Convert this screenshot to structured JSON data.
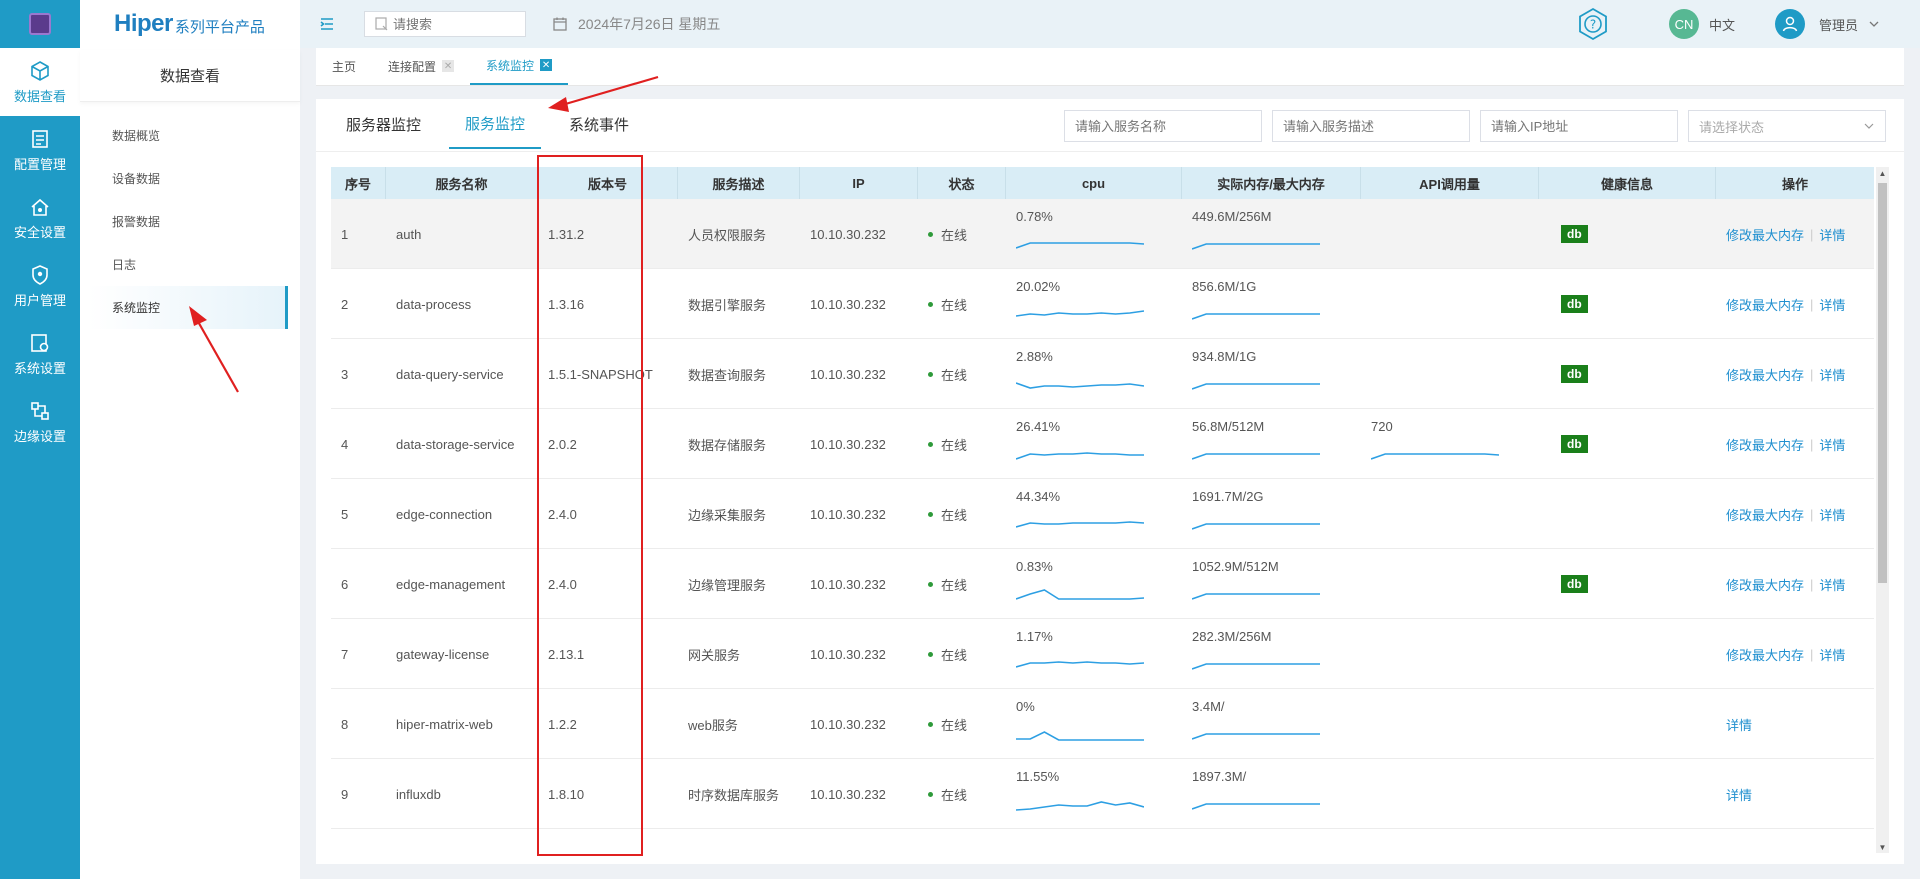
{
  "rail": [
    {
      "label": "数据查看",
      "icon": "cube-icon",
      "active": true
    },
    {
      "label": "配置管理",
      "icon": "config-icon",
      "active": false
    },
    {
      "label": "安全设置",
      "icon": "security-icon",
      "active": false
    },
    {
      "label": "用户管理",
      "icon": "user-shield-icon",
      "active": false
    },
    {
      "label": "系统设置",
      "icon": "system-settings-icon",
      "active": false
    },
    {
      "label": "边缘设置",
      "icon": "edge-icon",
      "active": false
    }
  ],
  "brand": {
    "name": "Hiper",
    "suffix": "系列平台产品"
  },
  "sidebar": {
    "title": "数据查看",
    "items": [
      {
        "label": "数据概览"
      },
      {
        "label": "设备数据"
      },
      {
        "label": "报警数据"
      },
      {
        "label": "日志"
      },
      {
        "label": "系统监控"
      }
    ]
  },
  "header": {
    "search_placeholder": "请搜索",
    "date": "2024年7月26日 星期五",
    "lang_badge": "CN",
    "lang_label": "中文",
    "user": "管理员"
  },
  "page_tabs": [
    {
      "label": "主页"
    },
    {
      "label": "连接配置"
    },
    {
      "label": "系统监控"
    }
  ],
  "sub_tabs": [
    {
      "label": "服务器监控"
    },
    {
      "label": "服务监控"
    },
    {
      "label": "系统事件"
    }
  ],
  "filters": {
    "name_placeholder": "请输入服务名称",
    "desc_placeholder": "请输入服务描述",
    "ip_placeholder": "请输入IP地址",
    "status_placeholder": "请选择状态"
  },
  "table": {
    "columns": [
      "序号",
      "服务名称",
      "版本号",
      "服务描述",
      "IP",
      "状态",
      "cpu",
      "实际内存/最大内存",
      "API调用量",
      "健康信息",
      "操作"
    ],
    "rows": [
      {
        "no": "1",
        "name": "auth",
        "version": "1.31.2",
        "desc": "人员权限服务",
        "ip": "10.10.30.232",
        "status": "在线",
        "cpu": "0.78%",
        "mem": "449.6M/256M",
        "api": "",
        "health": "db",
        "ops": [
          "修改最大内存",
          "详情"
        ]
      },
      {
        "no": "2",
        "name": "data-process",
        "version": "1.3.16",
        "desc": "数据引擎服务",
        "ip": "10.10.30.232",
        "status": "在线",
        "cpu": "20.02%",
        "mem": "856.6M/1G",
        "api": "",
        "health": "db",
        "ops": [
          "修改最大内存",
          "详情"
        ]
      },
      {
        "no": "3",
        "name": "data-query-service",
        "version": "1.5.1-SNAPSHOT",
        "desc": "数据查询服务",
        "ip": "10.10.30.232",
        "status": "在线",
        "cpu": "2.88%",
        "mem": "934.8M/1G",
        "api": "",
        "health": "db",
        "ops": [
          "修改最大内存",
          "详情"
        ]
      },
      {
        "no": "4",
        "name": "data-storage-service",
        "version": "2.0.2",
        "desc": "数据存储服务",
        "ip": "10.10.30.232",
        "status": "在线",
        "cpu": "26.41%",
        "mem": "56.8M/512M",
        "api": "720",
        "health": "db",
        "ops": [
          "修改最大内存",
          "详情"
        ]
      },
      {
        "no": "5",
        "name": "edge-connection",
        "version": "2.4.0",
        "desc": "边缘采集服务",
        "ip": "10.10.30.232",
        "status": "在线",
        "cpu": "44.34%",
        "mem": "1691.7M/2G",
        "api": "",
        "health": "",
        "ops": [
          "修改最大内存",
          "详情"
        ]
      },
      {
        "no": "6",
        "name": "edge-management",
        "version": "2.4.0",
        "desc": "边缘管理服务",
        "ip": "10.10.30.232",
        "status": "在线",
        "cpu": "0.83%",
        "mem": "1052.9M/512M",
        "api": "",
        "health": "db",
        "ops": [
          "修改最大内存",
          "详情"
        ]
      },
      {
        "no": "7",
        "name": "gateway-license",
        "version": "2.13.1",
        "desc": "网关服务",
        "ip": "10.10.30.232",
        "status": "在线",
        "cpu": "1.17%",
        "mem": "282.3M/256M",
        "api": "",
        "health": "",
        "ops": [
          "修改最大内存",
          "详情"
        ]
      },
      {
        "no": "8",
        "name": "hiper-matrix-web",
        "version": "1.2.2",
        "desc": "web服务",
        "ip": "10.10.30.232",
        "status": "在线",
        "cpu": "0%",
        "mem": "3.4M/",
        "api": "",
        "health": "",
        "ops": [
          "详情"
        ]
      },
      {
        "no": "9",
        "name": "influxdb",
        "version": "1.8.10",
        "desc": "时序数据库服务",
        "ip": "10.10.30.232",
        "status": "在线",
        "cpu": "11.55%",
        "mem": "1897.3M/",
        "api": "",
        "health": "",
        "ops": [
          "详情"
        ]
      }
    ]
  },
  "colors": {
    "accent": "#1f9bc6",
    "rail": "#1f9bc6",
    "health": "#1a7f1a",
    "annotation": "#e02020"
  }
}
